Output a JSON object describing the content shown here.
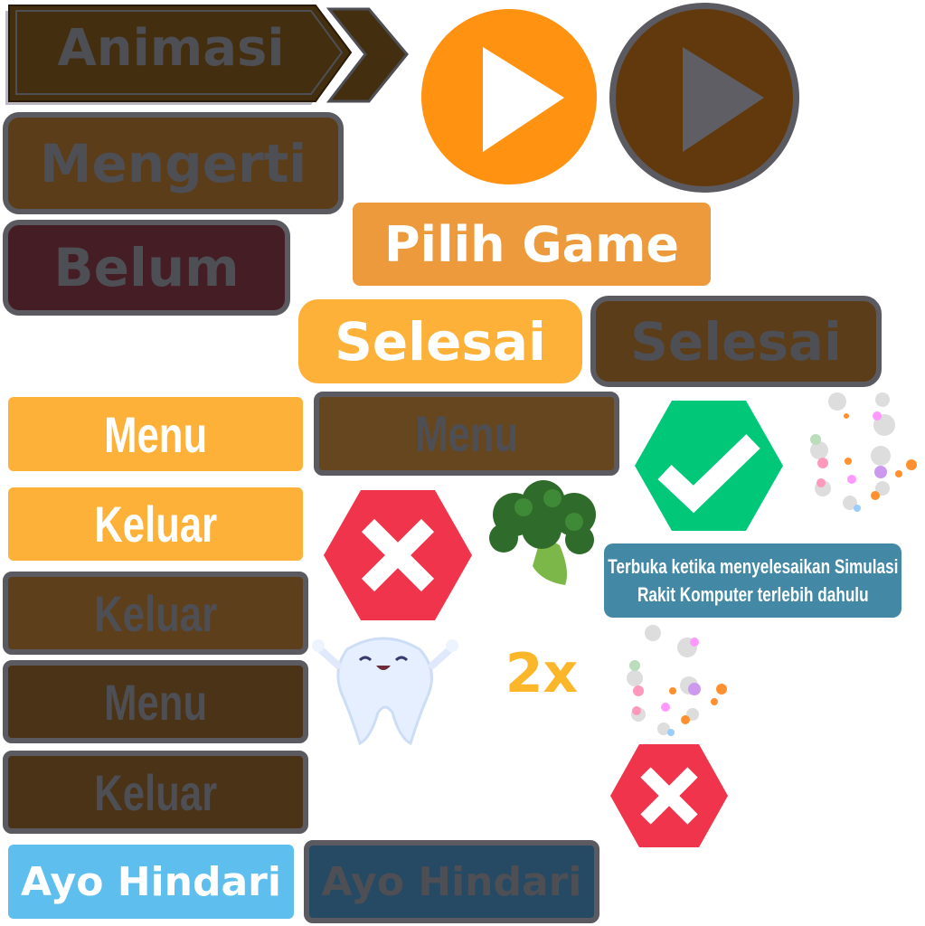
{
  "buttons": {
    "animasi": "Animasi",
    "mengerti": "Mengerti",
    "belum": "Belum",
    "pilih_game": "Pilih Game",
    "selesai_active": "Selesai",
    "selesai_inactive": "Selesai",
    "menu_active": "Menu",
    "menu_inactive": "Menu",
    "keluar_active": "Keluar",
    "keluar_inactive": "Keluar",
    "menu_dark": "Menu",
    "keluar_dark": "Keluar",
    "ayo_hindari_active": "Ayo Hindari",
    "ayo_hindari_inactive": "Ayo Hindari"
  },
  "tooltip": {
    "line1": "Terbuka ketika menyelesaikan Simulasi",
    "line2": "Rakit Komputer terlebih dahulu"
  },
  "multiplier": "2x",
  "icons": [
    "play-icon",
    "play-icon-disabled",
    "check-icon",
    "close-icon",
    "broccoli-icon",
    "tooth-icon",
    "sparkle-icon",
    "chevron-right-icon"
  ],
  "colors": {
    "orange": "#fdb138",
    "dark_orange": "#ec9a3c",
    "play_orange": "#ff9210",
    "brown": "#5b3d1a",
    "dark_brown": "#4a3317",
    "maroon": "#451d24",
    "green": "#00c878",
    "red": "#f0344b",
    "teal": "#4389a5",
    "sky": "#5ebfee",
    "navy": "#264a63",
    "disabled_text": "#4e4e55"
  }
}
